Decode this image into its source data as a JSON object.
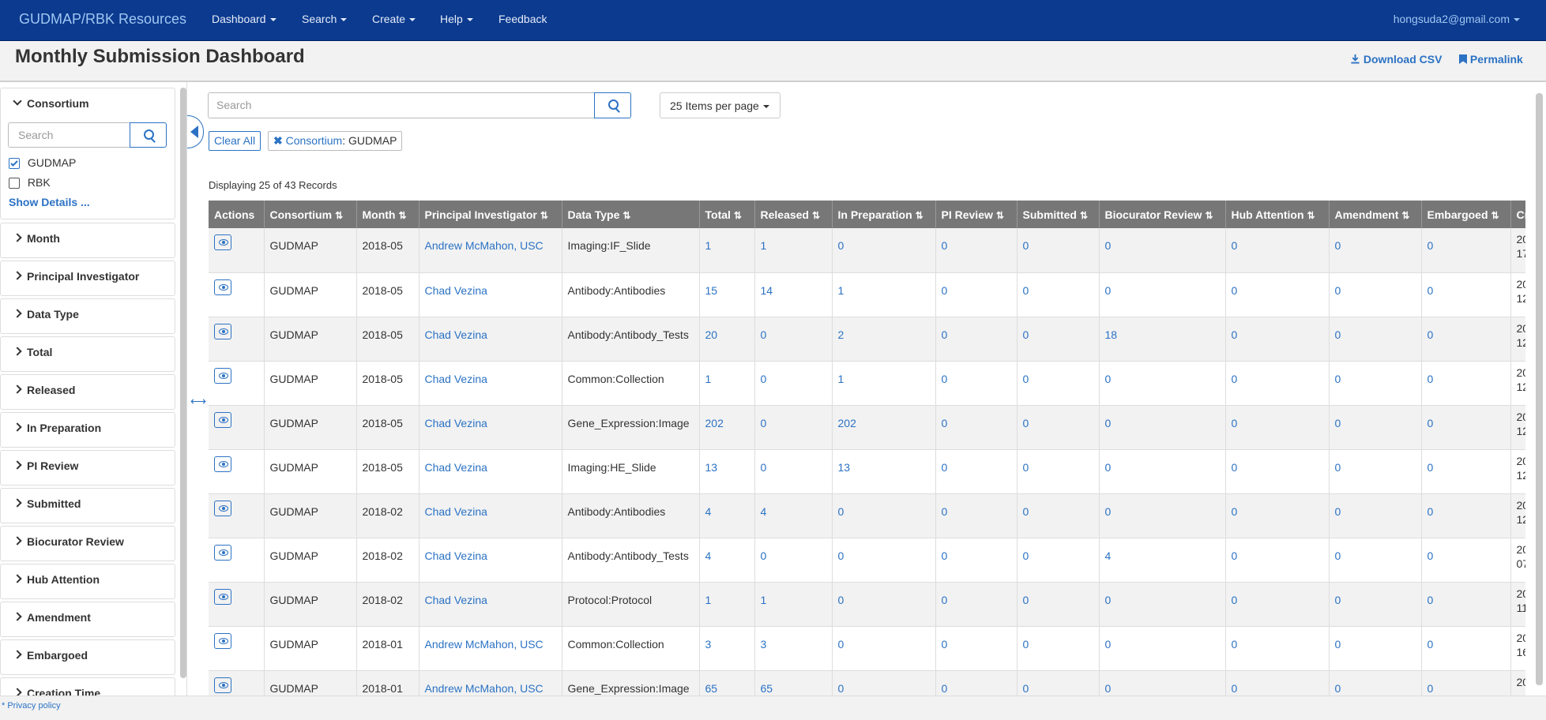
{
  "navbar": {
    "brand": "GUDMAP/RBK Resources",
    "items": [
      {
        "label": "Dashboard"
      },
      {
        "label": "Search"
      },
      {
        "label": "Create"
      },
      {
        "label": "Help"
      },
      {
        "label": "Feedback"
      }
    ],
    "user": "hongsuda2@gmail.com"
  },
  "header": {
    "title": "Monthly Submission Dashboard",
    "download_label": "Download CSV",
    "permalink_label": "Permalink"
  },
  "sidebar": {
    "consortium": {
      "label": "Consortium",
      "search_placeholder": "Search",
      "options": [
        {
          "label": "GUDMAP",
          "checked": true
        },
        {
          "label": "RBK",
          "checked": false
        }
      ],
      "show_details": "Show Details ..."
    },
    "facets": [
      "Month",
      "Principal Investigator",
      "Data Type",
      "Total",
      "Released",
      "In Preparation",
      "PI Review",
      "Submitted",
      "Biocurator Review",
      "Hub Attention",
      "Amendment",
      "Embargoed",
      "Creation Time"
    ]
  },
  "main": {
    "search_placeholder": "Search",
    "page_size": "25 Items per page",
    "clear_all": "Clear All",
    "filter_chip": {
      "facet": "Consortium",
      "value": ": GUDMAP"
    },
    "displaying": "Displaying 25 of 43 Records"
  },
  "footer": {
    "privacy": "Privacy policy"
  },
  "colors": {
    "navbar": "#0b3a8f",
    "link": "#2b72c4",
    "table_header": "#777777"
  },
  "table": {
    "headers": [
      "Actions",
      "Consortium",
      "Month",
      "Principal Investigator",
      "Data Type",
      "Total",
      "Released",
      "In Preparation",
      "PI Review",
      "Submitted",
      "Biocurator Review",
      "Hub Attention",
      "Amendment",
      "Embargoed",
      "Cr"
    ],
    "rows": [
      [
        "GUDMAP",
        "2018-05",
        "Andrew McMahon, USC",
        "Imaging:IF_Slide",
        "1",
        "1",
        "0",
        "0",
        "0",
        "0",
        "0",
        "0",
        "0",
        "20",
        "17"
      ],
      [
        "GUDMAP",
        "2018-05",
        "Chad Vezina",
        "Antibody:Antibodies",
        "15",
        "14",
        "1",
        "0",
        "0",
        "0",
        "0",
        "0",
        "0",
        "20",
        "12"
      ],
      [
        "GUDMAP",
        "2018-05",
        "Chad Vezina",
        "Antibody:Antibody_Tests",
        "20",
        "0",
        "2",
        "0",
        "0",
        "18",
        "0",
        "0",
        "0",
        "20",
        "12"
      ],
      [
        "GUDMAP",
        "2018-05",
        "Chad Vezina",
        "Common:Collection",
        "1",
        "0",
        "1",
        "0",
        "0",
        "0",
        "0",
        "0",
        "0",
        "20",
        "12"
      ],
      [
        "GUDMAP",
        "2018-05",
        "Chad Vezina",
        "Gene_Expression:Image",
        "202",
        "0",
        "202",
        "0",
        "0",
        "0",
        "0",
        "0",
        "0",
        "20",
        "12"
      ],
      [
        "GUDMAP",
        "2018-05",
        "Chad Vezina",
        "Imaging:HE_Slide",
        "13",
        "0",
        "13",
        "0",
        "0",
        "0",
        "0",
        "0",
        "0",
        "20",
        "12"
      ],
      [
        "GUDMAP",
        "2018-02",
        "Chad Vezina",
        "Antibody:Antibodies",
        "4",
        "4",
        "0",
        "0",
        "0",
        "0",
        "0",
        "0",
        "0",
        "20",
        "12"
      ],
      [
        "GUDMAP",
        "2018-02",
        "Chad Vezina",
        "Antibody:Antibody_Tests",
        "4",
        "0",
        "0",
        "0",
        "0",
        "4",
        "0",
        "0",
        "0",
        "20",
        "07"
      ],
      [
        "GUDMAP",
        "2018-02",
        "Chad Vezina",
        "Protocol:Protocol",
        "1",
        "1",
        "0",
        "0",
        "0",
        "0",
        "0",
        "0",
        "0",
        "20",
        "11"
      ],
      [
        "GUDMAP",
        "2018-01",
        "Andrew McMahon, USC",
        "Common:Collection",
        "3",
        "3",
        "0",
        "0",
        "0",
        "0",
        "0",
        "0",
        "0",
        "20",
        "16"
      ],
      [
        "GUDMAP",
        "2018-01",
        "Andrew McMahon, USC",
        "Gene_Expression:Image",
        "65",
        "65",
        "0",
        "0",
        "0",
        "0",
        "0",
        "0",
        "0",
        "20",
        ""
      ]
    ]
  }
}
